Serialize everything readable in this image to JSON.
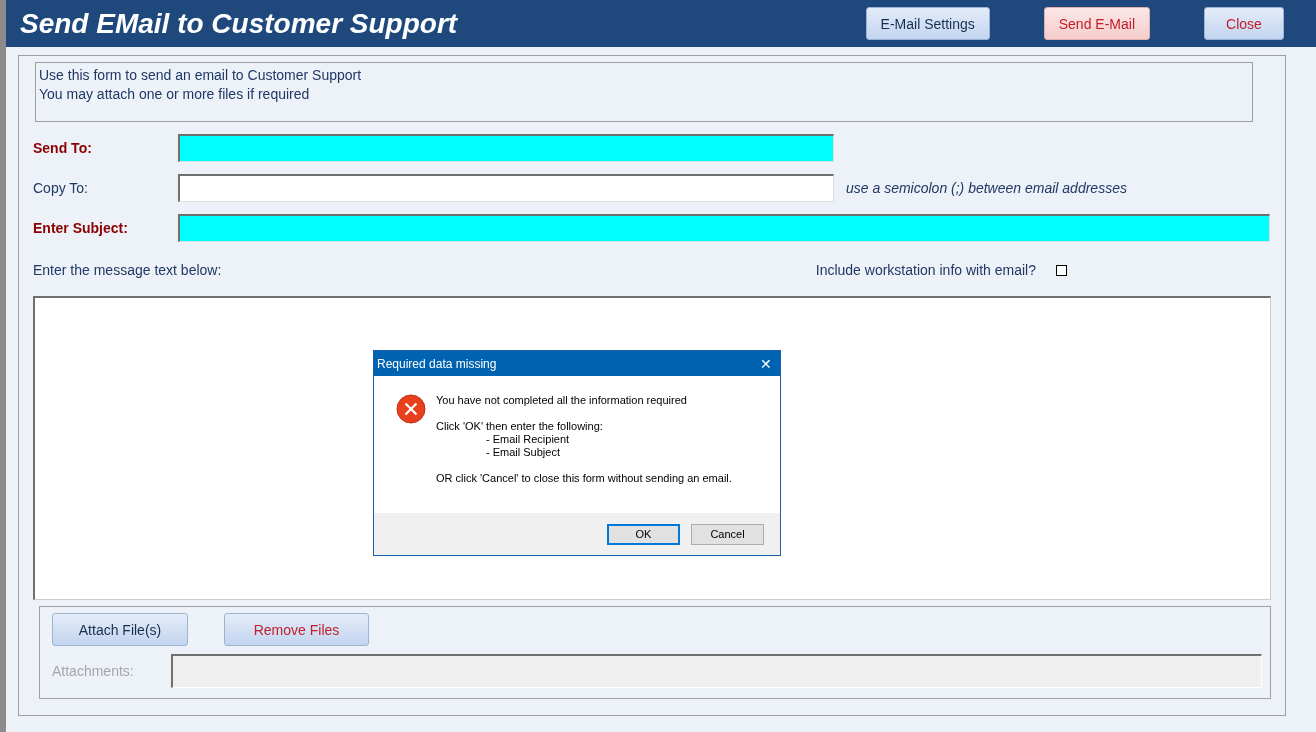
{
  "header": {
    "title": "Send EMail to Customer Support",
    "buttons": [
      {
        "label": "E-Mail Settings",
        "kind": "normal"
      },
      {
        "label": "Send E-Mail",
        "kind": "primary"
      },
      {
        "label": "Close",
        "kind": "danger"
      }
    ]
  },
  "intro": [
    "Use this form to send an email to Customer Support",
    "You may attach one or more files if required"
  ],
  "fields": [
    {
      "label": "Send To:",
      "required": true,
      "wide": false
    },
    {
      "label": "Copy To:",
      "required": false,
      "wide": false,
      "hint": "use a semicolon (;) between email addresses"
    },
    {
      "label": "Enter Subject:",
      "required": true,
      "wide": true
    }
  ],
  "message_label": "Enter the message text below:",
  "workstation": {
    "label": "Include workstation info with email?",
    "checked": false
  },
  "attachments": {
    "buttons": [
      {
        "label": "Attach File(s)",
        "kind": "normal"
      },
      {
        "label": "Remove Files",
        "kind": "danger"
      }
    ],
    "label": "Attachments:",
    "disabled": true
  },
  "dialog": {
    "title": "Required data missing",
    "close": "✕",
    "message": "You have not completed all the information required",
    "instruction": "Click 'OK' then enter the following:",
    "items": [
      "- Email Recipient",
      "- Email Subject"
    ],
    "alternative": "OR click 'Cancel' to close this form without sending an email.",
    "buttons": [
      {
        "label": "OK",
        "focused": true
      },
      {
        "label": "Cancel",
        "focused": false
      }
    ]
  }
}
